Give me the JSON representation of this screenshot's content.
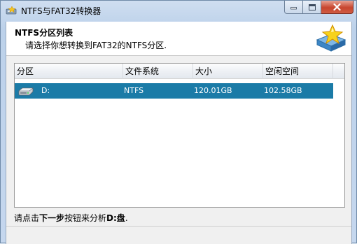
{
  "window": {
    "title": "NTFS与FAT32转换器"
  },
  "header": {
    "title": "NTFS分区列表",
    "subtitle": "请选择你想转换到FAT32的NTFS分区."
  },
  "table": {
    "columns": [
      "分区",
      "文件系统",
      "大小",
      "空闲空间"
    ],
    "rows": [
      {
        "partition": "D:",
        "filesystem": "NTFS",
        "size": "120.01GB",
        "free": "102.58GB",
        "selected": true,
        "icon": "drive-icon"
      }
    ]
  },
  "footer": {
    "prefix": "请点击",
    "button_name": "下一步",
    "middle": "按钮来分析",
    "drive": "D:盘",
    "suffix": "."
  },
  "colors": {
    "selection": "#1b7ba7",
    "close_button": "#c7452e"
  }
}
